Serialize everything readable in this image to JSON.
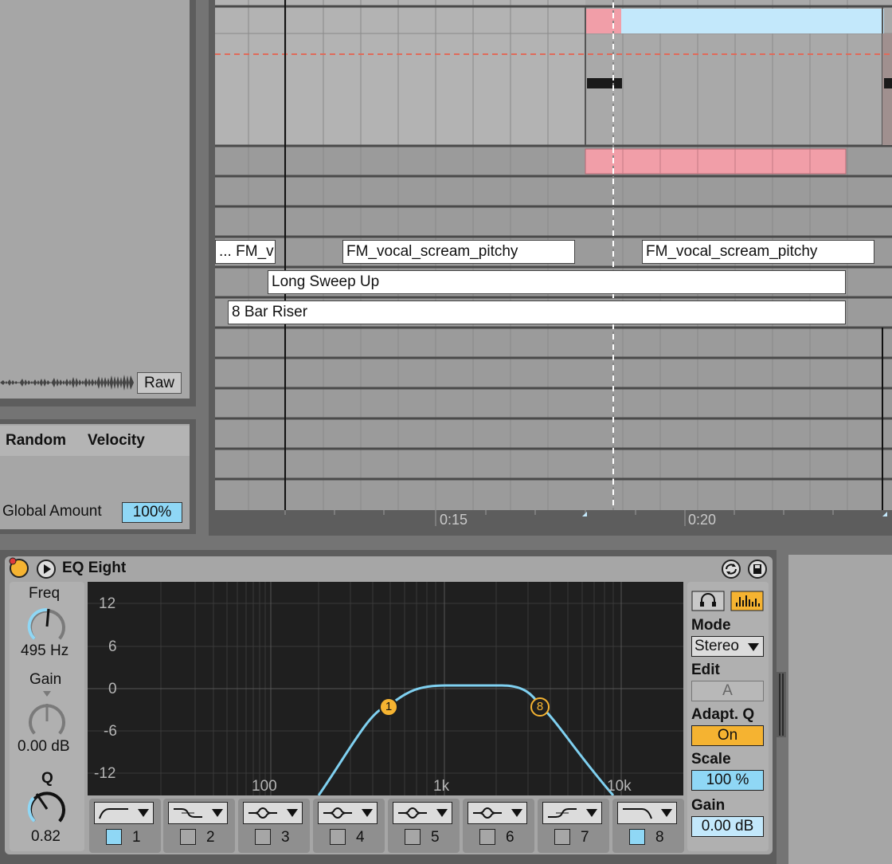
{
  "browser": {
    "raw_label": "Raw",
    "modulation": {
      "col1": "Random",
      "col2": "Velocity",
      "global_amount_label": "Global Amount",
      "global_amount_value": "100%"
    }
  },
  "arrangement": {
    "clips": [
      {
        "name": "... FM_v"
      },
      {
        "name": "FM_vocal_scream_pitchy"
      },
      {
        "name": "FM_vocal_scream_pitchy"
      },
      {
        "name": "Long Sweep Up"
      },
      {
        "name": "8 Bar Riser"
      }
    ],
    "time_labels": [
      "0:15",
      "0:20"
    ]
  },
  "device": {
    "title": "EQ Eight",
    "freq_label": "Freq",
    "freq_value": "495 Hz",
    "gain_label": "Gain",
    "gain_value": "0.00 dB",
    "q_label": "Q",
    "q_value": "0.82",
    "y_axis": [
      "12",
      "6",
      "0",
      "-6",
      "-12"
    ],
    "x_axis": [
      "100",
      "1k",
      "10k"
    ],
    "markers": [
      "1",
      "8"
    ],
    "bands": [
      {
        "num": "1",
        "on": true,
        "shape": "lowcut"
      },
      {
        "num": "2",
        "on": false,
        "shape": "lowshelf"
      },
      {
        "num": "3",
        "on": false,
        "shape": "bell"
      },
      {
        "num": "4",
        "on": false,
        "shape": "bell"
      },
      {
        "num": "5",
        "on": false,
        "shape": "bell"
      },
      {
        "num": "6",
        "on": false,
        "shape": "bell"
      },
      {
        "num": "7",
        "on": false,
        "shape": "highshelf"
      },
      {
        "num": "8",
        "on": true,
        "shape": "highcut"
      }
    ],
    "mode_label": "Mode",
    "mode_value": "Stereo",
    "edit_label": "Edit",
    "edit_value": "A",
    "adaptq_label": "Adapt. Q",
    "adaptq_value": "On",
    "scale_label": "Scale",
    "scale_value": "100 %",
    "out_gain_label": "Gain",
    "out_gain_value": "0.00 dB"
  },
  "colors": {
    "accent_orange": "#f5b331",
    "accent_blue": "#8fd7f5",
    "clip_pink": "#f19ea8",
    "clip_lightblue": "#c3e8fb",
    "curve": "#7fd0f0"
  }
}
